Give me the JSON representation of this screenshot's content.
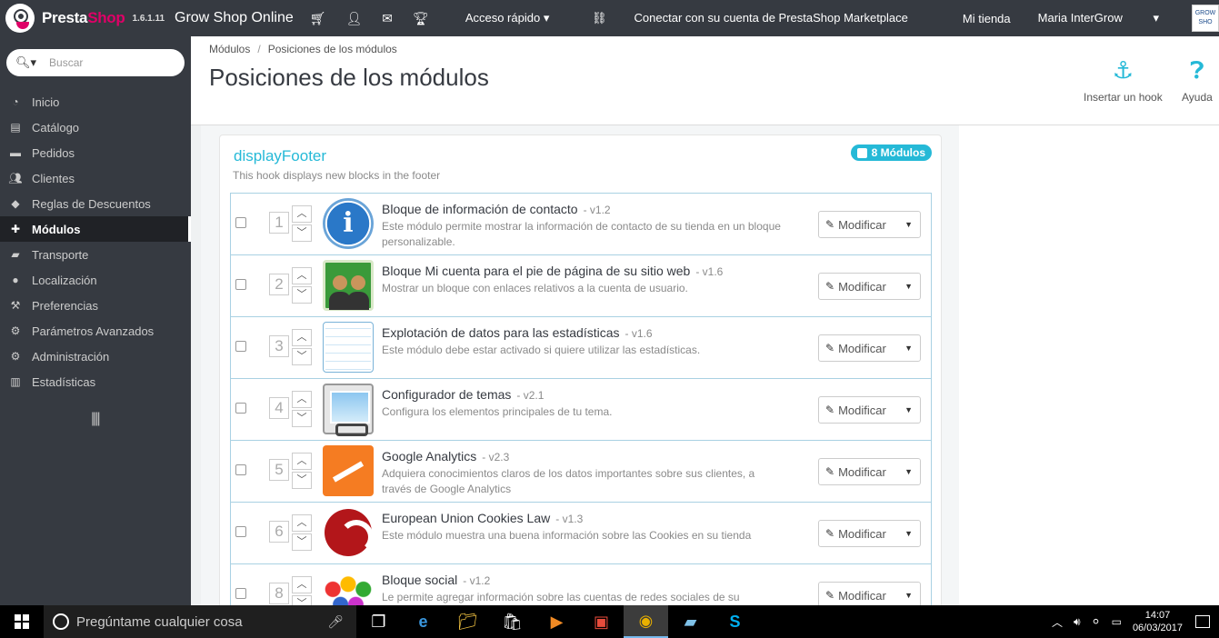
{
  "topbar": {
    "brand_a": "Presta",
    "brand_b": "Shop",
    "version": "1.6.1.11",
    "shop_name": "Grow Shop Online",
    "quick_access": "Acceso rápido",
    "marketplace": "Conectar con su cuenta de PrestaShop Marketplace",
    "my_shop": "Mi tienda",
    "user": "Maria InterGrow",
    "avatar_text": "GROW SHO"
  },
  "search": {
    "placeholder": "Buscar"
  },
  "sidebar": {
    "items": [
      {
        "label": "Inicio",
        "icon": "dashboard-icon"
      },
      {
        "label": "Catálogo",
        "icon": "book-icon"
      },
      {
        "label": "Pedidos",
        "icon": "credit-card-icon"
      },
      {
        "label": "Clientes",
        "icon": "users-icon"
      },
      {
        "label": "Reglas de Descuentos",
        "icon": "tag-icon"
      },
      {
        "label": "Módulos",
        "icon": "puzzle-icon"
      },
      {
        "label": "Transporte",
        "icon": "truck-icon"
      },
      {
        "label": "Localización",
        "icon": "globe-icon"
      },
      {
        "label": "Preferencias",
        "icon": "wrench-icon"
      },
      {
        "label": "Parámetros Avanzados",
        "icon": "cogs-icon"
      },
      {
        "label": "Administración",
        "icon": "gear-icon"
      },
      {
        "label": "Estadísticas",
        "icon": "bar-chart-icon"
      }
    ],
    "active_index": 5
  },
  "header": {
    "breadcrumb": [
      "Módulos",
      "Posiciones de los módulos"
    ],
    "title": "Posiciones de los módulos",
    "hook_button": "Insertar un hook",
    "help_button": "Ayuda"
  },
  "hook": {
    "name": "displayFooter",
    "description": "This hook displays new blocks in the footer",
    "count_label": "8 Módulos"
  },
  "modules": [
    {
      "pos": "1",
      "name": "Bloque de información de contacto",
      "version": "- v1.2",
      "desc": "Este módulo permite mostrar la información de contacto de su tienda en un bloque personalizable.",
      "icon": "info-icon"
    },
    {
      "pos": "2",
      "name": "Bloque Mi cuenta para el pie de página de su sitio web",
      "version": "- v1.6",
      "desc": "Mostrar un bloque con enlaces relativos a la cuenta de usuario.",
      "icon": "account-icon"
    },
    {
      "pos": "3",
      "name": "Explotación de datos para las estadísticas",
      "version": "- v1.6",
      "desc": "Este módulo debe estar activado si quiere utilizar las estadísticas.",
      "icon": "stats-icon"
    },
    {
      "pos": "4",
      "name": "Configurador de temas",
      "version": "- v2.1",
      "desc": "Configura los elementos principales de tu tema.",
      "icon": "theme-icon"
    },
    {
      "pos": "5",
      "name": "Google Analytics",
      "version": "- v2.3",
      "desc": "Adquiera conocimientos claros de los datos importantes sobre sus clientes, a través de Google Analytics",
      "icon": "google-analytics-icon"
    },
    {
      "pos": "6",
      "name": "European Union Cookies Law",
      "version": "- v1.3",
      "desc": "Este módulo muestra una buena información sobre las Cookies en su tienda",
      "icon": "cookie-icon"
    },
    {
      "pos": "8",
      "name": "Bloque social",
      "version": "- v1.2",
      "desc": "Le permite agregar información sobre las cuentas de redes sociales de su",
      "icon": "social-icon"
    }
  ],
  "modify_label": "Modificar",
  "taskbar": {
    "search_placeholder": "Pregúntame cualquier cosa",
    "time": "14:07",
    "date": "06/03/2017"
  }
}
